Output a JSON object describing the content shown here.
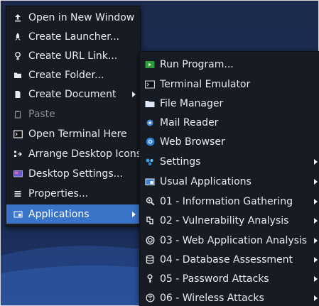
{
  "main_menu": {
    "items": [
      {
        "label": "Open in New Window",
        "icon": "upload-icon",
        "submenu": false
      },
      {
        "label": "Create Launcher...",
        "icon": "launcher-icon",
        "submenu": false
      },
      {
        "label": "Create URL Link...",
        "icon": "link-icon",
        "submenu": false
      },
      {
        "label": "Create Folder...",
        "icon": "folder-icon",
        "submenu": false
      },
      {
        "label": "Create Document",
        "icon": "document-icon",
        "submenu": true
      },
      {
        "label": "Paste",
        "icon": "paste-icon",
        "submenu": false,
        "disabled": true
      },
      {
        "label": "Open Terminal Here",
        "icon": "terminal-icon",
        "submenu": false
      },
      {
        "label": "Arrange Desktop Icons",
        "icon": "arrange-icon",
        "submenu": false
      },
      {
        "label": "Desktop Settings...",
        "icon": "desktop-settings-icon",
        "submenu": false
      },
      {
        "label": "Properties...",
        "icon": "properties-icon",
        "submenu": false
      },
      {
        "label": "Applications",
        "icon": "applications-icon",
        "submenu": true,
        "active": true
      }
    ]
  },
  "applications_menu": {
    "items": [
      {
        "label": "Run Program...",
        "icon": "run-program-icon",
        "submenu": false
      },
      {
        "label": "Terminal Emulator",
        "icon": "terminal-emulator-icon",
        "submenu": false
      },
      {
        "label": "File Manager",
        "icon": "file-manager-icon",
        "submenu": false
      },
      {
        "label": "Mail Reader",
        "icon": "mail-reader-icon",
        "submenu": false
      },
      {
        "label": "Web Browser",
        "icon": "web-browser-icon",
        "submenu": false
      },
      {
        "label": "Settings",
        "icon": "settings-icon",
        "submenu": true
      },
      {
        "label": "Usual Applications",
        "icon": "usual-applications-icon",
        "submenu": true
      },
      {
        "label": "01 - Information Gathering",
        "icon": "information-gathering-icon",
        "submenu": true
      },
      {
        "label": "02 - Vulnerability Analysis",
        "icon": "vulnerability-analysis-icon",
        "submenu": true
      },
      {
        "label": "03 - Web Application Analysis",
        "icon": "web-application-analysis-icon",
        "submenu": true
      },
      {
        "label": "04 - Database Assessment",
        "icon": "database-assessment-icon",
        "submenu": true
      },
      {
        "label": "05 - Password Attacks",
        "icon": "password-attacks-icon",
        "submenu": true
      },
      {
        "label": "06 - Wireless Attacks",
        "icon": "wireless-attacks-icon",
        "submenu": true
      }
    ]
  },
  "colors": {
    "menu_bg": "#171b23",
    "highlight": "#3a74c8",
    "text": "#e9ebef",
    "disabled_text": "#8a8e96",
    "desktop_bg": "#1d2b4e"
  }
}
